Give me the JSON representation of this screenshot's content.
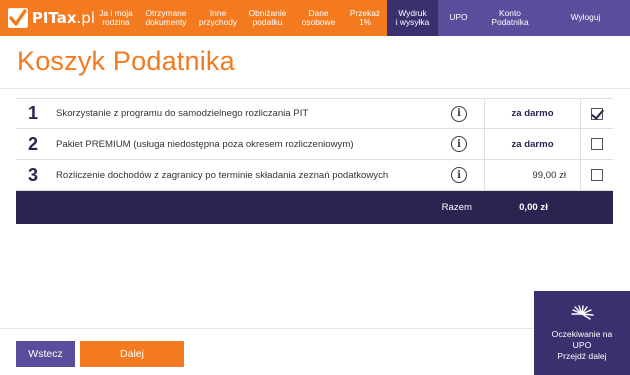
{
  "brand": {
    "name": "PITax",
    "tld": ".pl"
  },
  "nav": [
    {
      "label": "Ja i moja\nrodzina"
    },
    {
      "label": "Otrzymane\ndokumenty"
    },
    {
      "label": "Inne\nprzychody"
    },
    {
      "label": "Obniżanie\npodatku"
    },
    {
      "label": "Dane\nosobowe"
    },
    {
      "label": "Przekaż\n1%"
    },
    {
      "label": "Wydruk\ni wysyłka"
    },
    {
      "label": "UPO"
    },
    {
      "label": "Konto\nPodatnika"
    },
    {
      "label": "Wyloguj"
    }
  ],
  "page_title": "Koszyk Podatnika",
  "basket": {
    "items": [
      {
        "num": "1",
        "desc": "Skorzystanie z programu do samodzielnego rozliczania PIT",
        "info_icon": "info-icon",
        "price": "za darmo",
        "checked": true
      },
      {
        "num": "2",
        "desc": "Pakiet PREMIUM (usługa niedostępna poza okresem rozliczeniowym)",
        "info_icon": "info-icon",
        "price": "za darmo",
        "checked": false
      },
      {
        "num": "3",
        "desc": "Rozliczenie dochodów z zagranicy po terminie składania zeznań podatkowych",
        "info_icon": "info-icon",
        "price": "99,00 zł",
        "checked": false
      }
    ],
    "total_label": "Razem",
    "total_value": "0,00 zł"
  },
  "buttons": {
    "back": "Wstecz",
    "next": "Dalej"
  },
  "upo_panel": {
    "text": "Oczekiwanie na\nUPO\nPrzejdź dalej",
    "icon": "loading-spinner-icon"
  },
  "colors": {
    "orange": "#f47a20",
    "purple": "#5a4e9c",
    "dark_purple": "#3b2f6e",
    "navy": "#2b2350"
  }
}
